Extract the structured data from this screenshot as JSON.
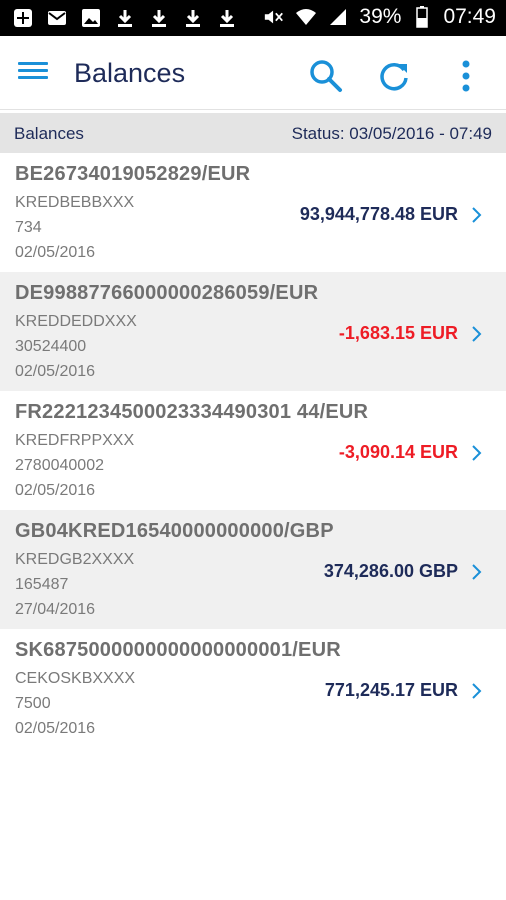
{
  "status_bar": {
    "battery_percent": "39%",
    "time": "07:49",
    "left_icons": [
      "add-box-icon",
      "gmail-icon",
      "image-icon",
      "download-icon",
      "download-icon",
      "download-icon",
      "download-icon"
    ],
    "right_icons": [
      "mute-icon",
      "wifi-icon",
      "signal-icon",
      "battery-icon"
    ]
  },
  "app_bar": {
    "title": "Balances",
    "icons": [
      "menu-icon",
      "search-icon",
      "refresh-icon",
      "more-vert-icon"
    ]
  },
  "section_header": {
    "label": "Balances",
    "status": "Status: 03/05/2016 - 07:49"
  },
  "colors": {
    "accent": "#1a90d8",
    "title": "#1e2b59",
    "negative": "#ee1c25",
    "header_bg": "#e4e4e4"
  },
  "accounts": [
    {
      "iban": "BE26734019052829/EUR",
      "bic": "KREDBEBBXXX",
      "code": "734",
      "date": "02/05/2016",
      "amount": "93,944,778.48 EUR",
      "negative": false
    },
    {
      "iban": "DE99887766000000286059/EUR",
      "bic": "KREDDEDDXXX",
      "code": "30524400",
      "date": "02/05/2016",
      "amount": "-1,683.15 EUR",
      "negative": true
    },
    {
      "iban": "FR2221234500023334490301 44/EUR",
      "bic": "KREDFRPPXXX",
      "code": "2780040002",
      "date": "02/05/2016",
      "amount": "-3,090.14 EUR",
      "negative": true
    },
    {
      "iban": "GB04KRED16540000000000/GBP",
      "bic": "KREDGB2XXXX",
      "code": "165487",
      "date": "27/04/2016",
      "amount": "374,286.00 GBP",
      "negative": false
    },
    {
      "iban": "SK6875000000000000000001/EUR",
      "bic": "CEKOSKBXXXX",
      "code": "7500",
      "date": "02/05/2016",
      "amount": "771,245.17 EUR",
      "negative": false
    }
  ]
}
